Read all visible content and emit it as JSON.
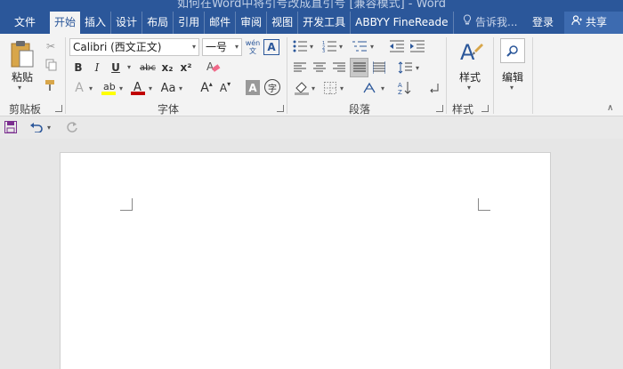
{
  "title_bar": {
    "title": "如何在Word中将引号改成直引号 [兼容模式] - Word"
  },
  "tabs": [
    "文件",
    "开始",
    "插入",
    "设计",
    "布局",
    "引用",
    "邮件",
    "审阅",
    "视图",
    "开发工具",
    "ABBYY FineReade"
  ],
  "active_tab": "开始",
  "tell_me": "告诉我...",
  "login": "登录",
  "share": "共享",
  "clipboard": {
    "paste_label": "粘贴",
    "group_label": "剪贴板"
  },
  "font": {
    "font_name": "Calibri (西文正文)",
    "font_size": "一号",
    "group_label": "字体",
    "bold": "B",
    "italic": "I",
    "underline": "U",
    "strike": "abc",
    "subscript": "x₂",
    "superscript": "x²",
    "change_case": "Aa",
    "grow": "A",
    "shrink": "A",
    "char_shading": "A",
    "enclose": "字",
    "wen": "wén 文"
  },
  "paragraph": {
    "group_label": "段落"
  },
  "styles": {
    "label": "样式",
    "group_label": "样式"
  },
  "editing": {
    "label": "编辑"
  },
  "colors": {
    "ribbon_blue": "#2b579a",
    "highlight": "#ffff00",
    "font_red": "#c00000"
  }
}
